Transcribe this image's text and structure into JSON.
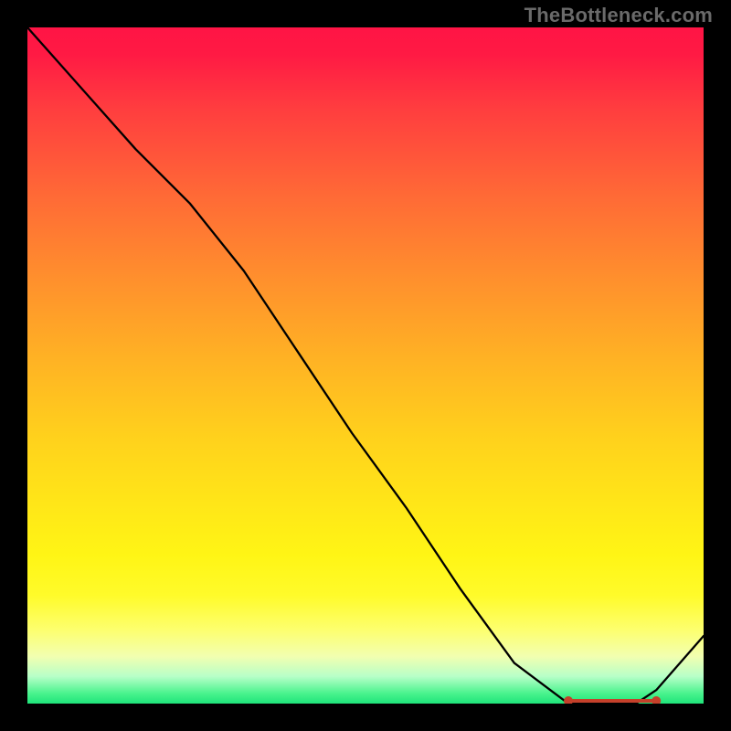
{
  "attribution": "TheBottleneck.com",
  "chart_data": {
    "type": "line",
    "title": "",
    "xlabel": "",
    "ylabel": "",
    "xlim": [
      0,
      100
    ],
    "ylim": [
      0,
      100
    ],
    "series": [
      {
        "name": "curve",
        "x": [
          0,
          8,
          16,
          24,
          32,
          40,
          48,
          56,
          64,
          72,
          80,
          82,
          86,
          90,
          93,
          100
        ],
        "y": [
          100,
          91,
          82,
          74,
          64,
          52,
          40,
          29,
          17,
          6,
          0,
          0,
          0,
          0,
          2,
          10
        ]
      }
    ],
    "markers": {
      "name": "optimal-range",
      "x_start": 80,
      "x_end": 93,
      "y": 0
    },
    "background_gradient": {
      "stops": [
        {
          "pos": 0.0,
          "color": "#ff1445"
        },
        {
          "pos": 0.5,
          "color": "#ffd21c"
        },
        {
          "pos": 0.85,
          "color": "#fdff6d"
        },
        {
          "pos": 1.0,
          "color": "#1fe47a"
        }
      ]
    }
  }
}
